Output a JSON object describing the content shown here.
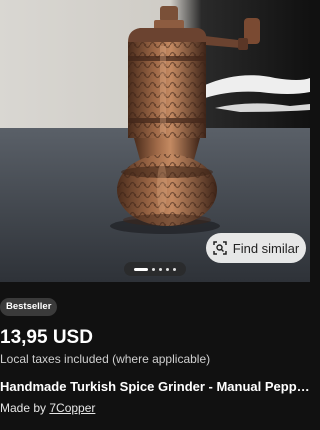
{
  "listing": {
    "badge": "Bestseller",
    "price": "13,95 USD",
    "tax_note": "Local taxes included (where applicable)",
    "title": "Handmade Turkish Spice Grinder - Manual Peppe...",
    "maker_prefix": "Made by ",
    "shop_name": "7Copper"
  },
  "image_actions": {
    "find_similar_label": "Find similar",
    "find_similar_icon": "visual-search-icon"
  },
  "carousel": {
    "slide_count": 5,
    "active_index": 0
  },
  "colors": {
    "background": "#111111",
    "copper": "#8a5a3c",
    "badge_bg": "#3a3a3a"
  }
}
